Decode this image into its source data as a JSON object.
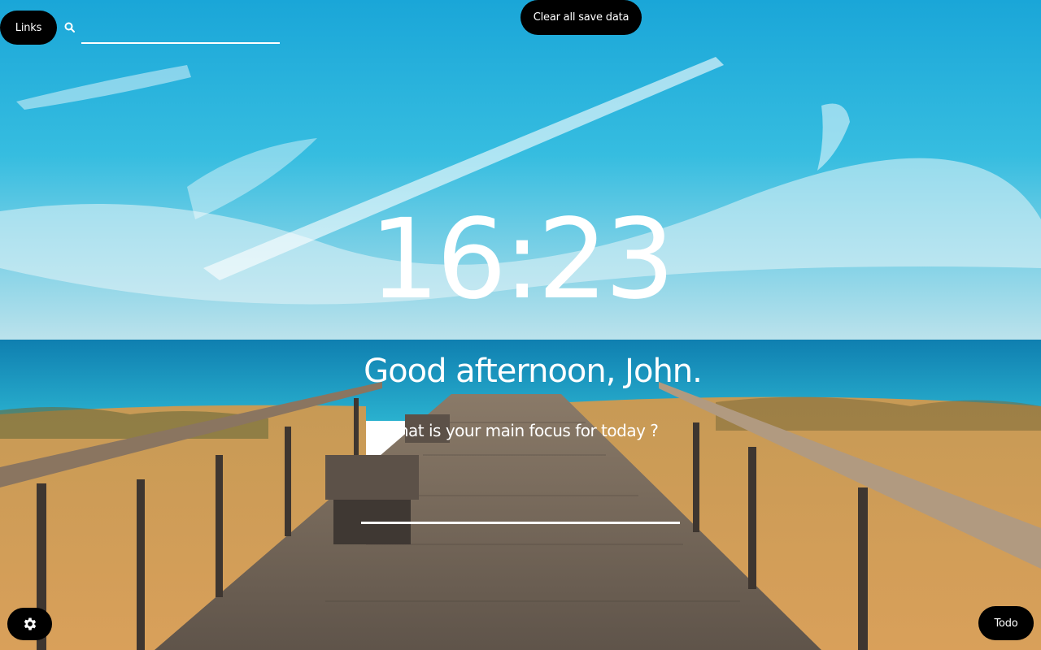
{
  "header": {
    "links_label": "Links",
    "search_placeholder": "",
    "search_value": "",
    "clear_label": "Clear all save data"
  },
  "main": {
    "time": "16:23",
    "greeting": "Good afternoon, John.",
    "focus_prompt": "What is your main focus for today ?",
    "focus_value": ""
  },
  "footer": {
    "todo_label": "Todo"
  },
  "icons": {
    "search": "search-icon",
    "settings": "gear-icon"
  },
  "colors": {
    "button_bg": "#000000",
    "text": "#ffffff"
  }
}
